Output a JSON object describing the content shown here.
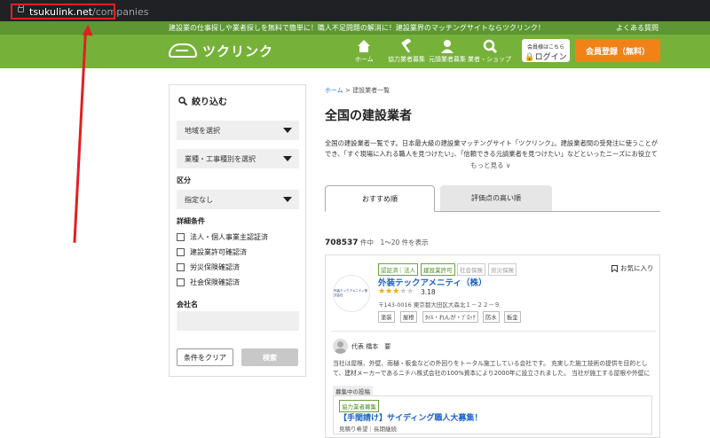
{
  "browser": {
    "url_host": "tsukulink.net",
    "url_path": "/companies"
  },
  "site": {
    "tagline": "建設業の仕事探しや業者探しを無料で簡単に！職人不足問題の解消に！建設業界のマッチングサイトならツクリンク！",
    "faq": "よくある質問",
    "logo_text": "ツクリンク",
    "nav": [
      {
        "label": "ホーム",
        "icon": "house-icon"
      },
      {
        "label": "協力業者募集",
        "icon": "hammer-icon"
      },
      {
        "label": "元請業者募集",
        "icon": "worker-icon"
      },
      {
        "label": "業者・ショップ",
        "icon": "search-icon"
      }
    ],
    "login_small": "会員様はこちら",
    "login_label": "ログイン",
    "register_label": "会員登録（無料）",
    "brand_green": "#76b23a",
    "accent_orange": "#f08218"
  },
  "sidebar": {
    "title": "絞り込む",
    "region_select": "地域を選択",
    "industry_select": "業種・工事種別を選択",
    "category_label": "区分",
    "category_select": "指定なし",
    "details_label": "詳細条件",
    "checkboxes": [
      "法人・個人事業主認証済",
      "建設業許可確認済",
      "労災保険確認済",
      "社会保険確認済"
    ],
    "company_name_label": "会社名",
    "clear_button": "条件をクリア",
    "search_button": "検索"
  },
  "main": {
    "breadcrumb_home": "ホーム",
    "breadcrumb_current": " > 建設業者一覧",
    "title": "全国の建設業者",
    "description": "全国の建設業者一覧です。日本最大級の建設業マッチングサイト「ツクリンク」。建設業者間の受発注に使うことができ、「すぐ現場に入れる職人を見つけたい」、「信頼できる元請業者を見つけたい」などといったニーズにお役立てい",
    "more": "もっと見る ∨",
    "tabs": [
      "おすすめ順",
      "評価点の高い順"
    ],
    "count": "708537",
    "count_unit": " 件中　1〜20 件を表示"
  },
  "card": {
    "badges_active": [
      "認証済｜法人",
      "建設業許可"
    ],
    "badges_inactive": [
      "社会保険",
      "労災保険"
    ],
    "favorite": "お気に入り",
    "logo_text": "外装テックアメニティ株式会社",
    "name": "外装テックアメニティ（株）",
    "rating_value": 3.18,
    "rating_text": "3.18",
    "address": "〒143-0016 東京都大田区大森北１－２２－９",
    "tags": [
      "塗装",
      "屋根",
      "ﾀｲﾙ・れんが・ﾌﾞﾛｯｸ",
      "防水",
      "板金"
    ],
    "representative": "代表  橋本　要",
    "intro": "当社は屋根、外壁、雨樋・板金などの外回りをトータル施工している会社です。 充実した施工技術の提供を目的として、建材メーカーであるニチハ株式会社の100%資本により2000年に設立されました。 当社が施工する屋根や外壁により、大切な…",
    "recruit_label": "募集中の投稿",
    "recruit_badge": "協力業者募集",
    "recruit_title": "【手間請け】サイディング職人大募集！",
    "recruit_sub": "見積り希望｜長期継続"
  }
}
